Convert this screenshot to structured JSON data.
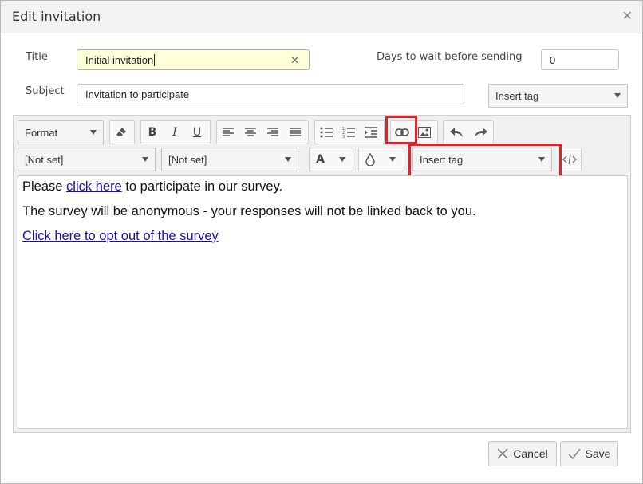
{
  "dialog": {
    "title": "Edit invitation"
  },
  "form": {
    "title_label": "Title",
    "title_value": "Initial invitation",
    "days_label": "Days to wait before sending",
    "days_value": "0",
    "subject_label": "Subject",
    "subject_value": "Invitation to participate",
    "insert_tag_label": "Insert tag"
  },
  "toolbar": {
    "format_label": "Format",
    "font_family": "[Not set]",
    "font_size": "[Not set]",
    "insert_tag_label": "Insert tag",
    "font_color_glyph": "A"
  },
  "content": {
    "p1_before": "Please ",
    "p1_link": "click here",
    "p1_after": " to participate in our survey.",
    "p2": "The survey will be anonymous - your responses will not be linked back to you.",
    "p3_link": "Click here to opt out of the survey"
  },
  "footer": {
    "cancel_label": "Cancel",
    "save_label": "Save"
  },
  "colors": {
    "highlight_box": "#e0202a",
    "link": "#1a0dab",
    "title_input_bg": "#ffffd8"
  }
}
